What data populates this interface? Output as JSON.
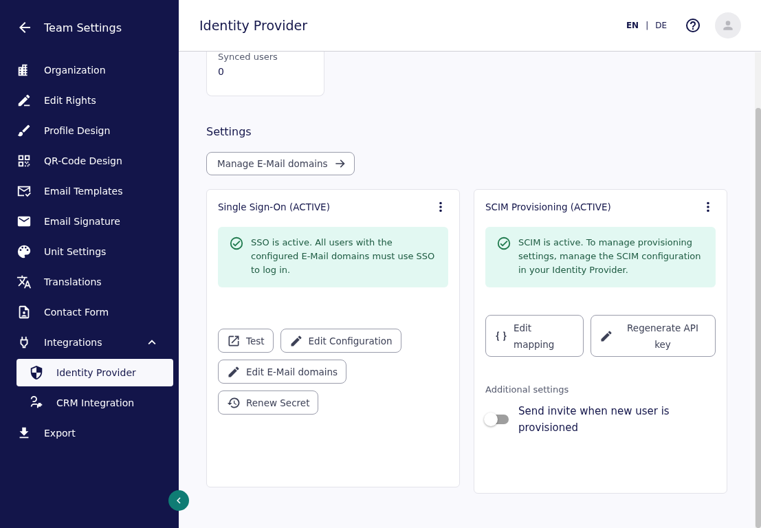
{
  "sidebar": {
    "title": "Team Settings",
    "items": [
      {
        "label": "Organization",
        "selected": false
      },
      {
        "label": "Edit Rights",
        "selected": false
      },
      {
        "label": "Profile Design",
        "selected": false
      },
      {
        "label": "QR-Code Design",
        "selected": false
      },
      {
        "label": "Email Templates",
        "selected": false
      },
      {
        "label": "Email Signature",
        "selected": false
      },
      {
        "label": "Unit Settings",
        "selected": false
      },
      {
        "label": "Translations",
        "selected": false
      },
      {
        "label": "Contact Form",
        "selected": false
      },
      {
        "label": "Integrations",
        "selected": false,
        "expanded": true,
        "children": [
          {
            "label": "Identity Provider",
            "selected": true
          },
          {
            "label": "CRM Integration",
            "selected": false
          }
        ]
      },
      {
        "label": "Export",
        "selected": false
      }
    ]
  },
  "header": {
    "title": "Identity Provider",
    "languages": [
      {
        "label": "EN",
        "selected": true
      },
      {
        "label": "DE",
        "selected": false
      }
    ],
    "separator": "|"
  },
  "stat": {
    "label": "Synced users",
    "value": "0"
  },
  "settings": {
    "title": "Settings",
    "manage_button": "Manage E-Mail domains",
    "cards": [
      {
        "title": "Single Sign-On (ACTIVE)",
        "notice": "SSO is active. All users with the configured E-Mail domains must use SSO to log in.",
        "buttons": [
          "Test",
          "Edit Configuration",
          "Edit E-Mail domains",
          "Renew Secret"
        ]
      },
      {
        "title": "SCIM Provisioning (ACTIVE)",
        "notice": "SCIM is active. To manage provisioning settings, manage the SCIM configuration in your Identity Provider.",
        "buttons": [
          "Edit mapping",
          "Regenerate API key"
        ],
        "additional": {
          "title": "Additional settings",
          "toggle": {
            "label": "Send invite when new user is provisioned",
            "on": false
          }
        }
      }
    ]
  }
}
